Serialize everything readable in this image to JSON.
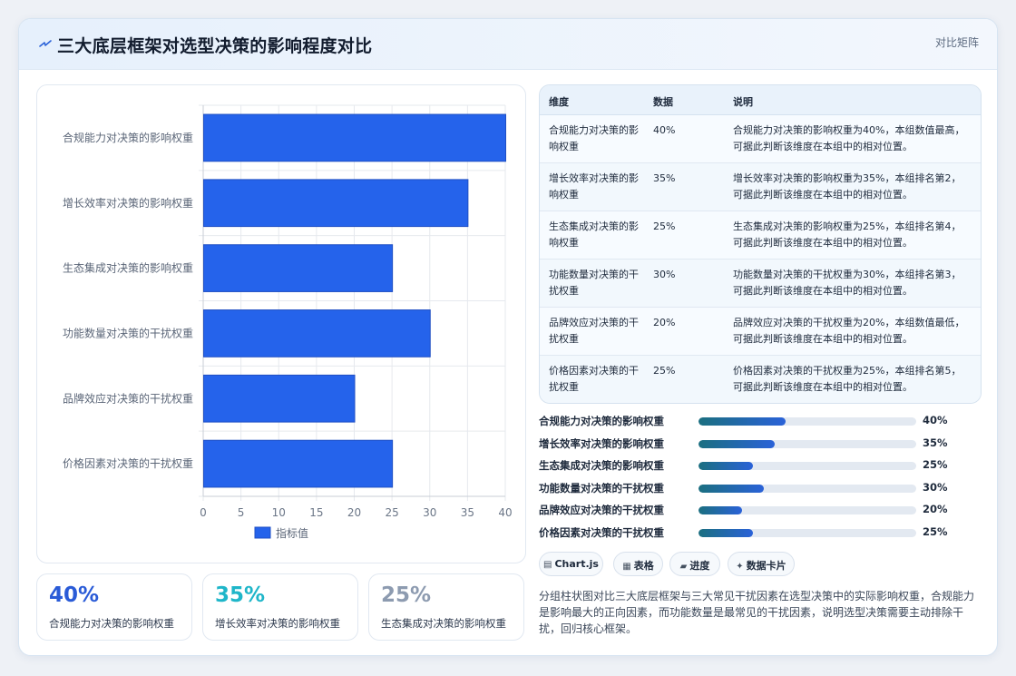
{
  "header": {
    "title": "三大底层框架对选型决策的影响程度对比",
    "tag": "对比矩阵",
    "icon": "lightning-icon"
  },
  "colors": {
    "bar": "#2563eb",
    "stat1": "#2a5bd7",
    "stat2": "#1fb6c9",
    "stat3": "#8d9bb0",
    "progress_start": "#1b6f80",
    "progress_end": "#2a62d8"
  },
  "chart_data": {
    "type": "bar",
    "orientation": "horizontal",
    "categories": [
      "合规能力对决策的影响权重",
      "增长效率对决策的影响权重",
      "生态集成对决策的影响权重",
      "功能数量对决策的干扰权重",
      "品牌效应对决策的干扰权重",
      "价格因素对决策的干扰权重"
    ],
    "series": [
      {
        "name": "指标值",
        "values": [
          40,
          35,
          25,
          30,
          20,
          25
        ]
      }
    ],
    "xlim": [
      0,
      40
    ],
    "xticks": [
      0,
      5,
      10,
      15,
      20,
      25,
      30,
      35,
      40
    ],
    "grid": true,
    "legend": "bottom"
  },
  "stats": [
    {
      "value": "40%",
      "label": "合规能力对决策的影响权重"
    },
    {
      "value": "35%",
      "label": "增长效率对决策的影响权重"
    },
    {
      "value": "25%",
      "label": "生态集成对决策的影响权重"
    }
  ],
  "table": {
    "headers": [
      "维度",
      "数据",
      "说明"
    ],
    "rows": [
      {
        "dim": "合规能力对决策的影响权重",
        "val": "40%",
        "desc": "合规能力对决策的影响权重为40%，本组数值最高，可据此判断该维度在本组中的相对位置。"
      },
      {
        "dim": "增长效率对决策的影响权重",
        "val": "35%",
        "desc": "增长效率对决策的影响权重为35%，本组排名第2，可据此判断该维度在本组中的相对位置。"
      },
      {
        "dim": "生态集成对决策的影响权重",
        "val": "25%",
        "desc": "生态集成对决策的影响权重为25%，本组排名第4，可据此判断该维度在本组中的相对位置。"
      },
      {
        "dim": "功能数量对决策的干扰权重",
        "val": "30%",
        "desc": "功能数量对决策的干扰权重为30%，本组排名第3，可据此判断该维度在本组中的相对位置。"
      },
      {
        "dim": "品牌效应对决策的干扰权重",
        "val": "20%",
        "desc": "品牌效应对决策的干扰权重为20%，本组数值最低，可据此判断该维度在本组中的相对位置。"
      },
      {
        "dim": "价格因素对决策的干扰权重",
        "val": "25%",
        "desc": "价格因素对决策的干扰权重为25%，本组排名第5，可据此判断该维度在本组中的相对位置。"
      }
    ]
  },
  "progress": [
    {
      "label": "合规能力对决策的影响权重",
      "value": 40,
      "text": "40%"
    },
    {
      "label": "增长效率对决策的影响权重",
      "value": 35,
      "text": "35%"
    },
    {
      "label": "生态集成对决策的影响权重",
      "value": 25,
      "text": "25%"
    },
    {
      "label": "功能数量对决策的干扰权重",
      "value": 30,
      "text": "30%"
    },
    {
      "label": "品牌效应对决策的干扰权重",
      "value": 20,
      "text": "20%"
    },
    {
      "label": "价格因素对决策的干扰权重",
      "value": 25,
      "text": "25%"
    }
  ],
  "progress_max": 100,
  "chips": [
    {
      "icon": "chart-icon",
      "label": "Chart.js"
    },
    {
      "icon": "table-icon",
      "label": "表格"
    },
    {
      "icon": "progress-icon",
      "label": "进度"
    },
    {
      "icon": "sparkle-icon",
      "label": "数据卡片"
    }
  ],
  "description": "分组柱状图对比三大底层框架与三大常见干扰因素在选型决策中的实际影响权重，合规能力是影响最大的正向因素，而功能数量是最常见的干扰因素，说明选型决策需要主动排除干扰，回归核心框架。"
}
